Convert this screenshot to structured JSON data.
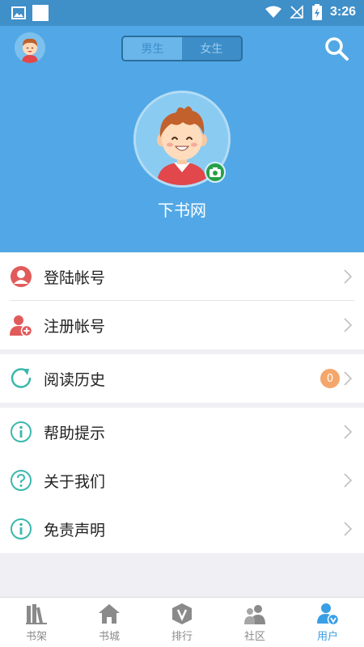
{
  "status_bar": {
    "time": "3:26"
  },
  "header": {
    "gender_tabs": [
      {
        "label": "男生",
        "active": true
      },
      {
        "label": "女生",
        "active": false
      }
    ],
    "site_name": "下书网"
  },
  "menu": {
    "account": [
      {
        "label": "登陆帐号",
        "icon": "user-icon"
      },
      {
        "label": "注册帐号",
        "icon": "add-user-icon"
      }
    ],
    "history": {
      "label": "阅读历史",
      "icon": "refresh-icon",
      "count": "0"
    },
    "info": [
      {
        "label": "帮助提示",
        "icon": "info-icon"
      },
      {
        "label": "关于我们",
        "icon": "question-icon"
      },
      {
        "label": "免责声明",
        "icon": "info-icon"
      }
    ]
  },
  "bottom_nav": [
    {
      "label": "书架",
      "icon": "bookshelf-icon",
      "active": false
    },
    {
      "label": "书城",
      "icon": "home-icon",
      "active": false
    },
    {
      "label": "排行",
      "icon": "ranking-icon",
      "active": false
    },
    {
      "label": "社区",
      "icon": "community-icon",
      "active": false
    },
    {
      "label": "用户",
      "icon": "user-verified-icon",
      "active": true
    }
  ],
  "colors": {
    "header_bg": "#52a8e6",
    "accent": "#3a9ee4",
    "icon_red": "#e15b5b",
    "icon_teal": "#3bb8ad",
    "badge": "#f5a66a"
  }
}
